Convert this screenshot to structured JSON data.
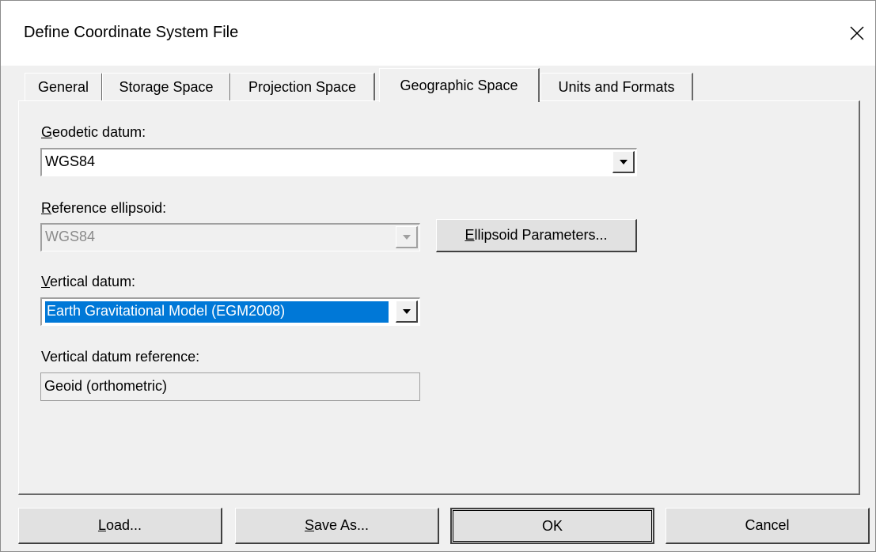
{
  "window": {
    "title": "Define Coordinate System File"
  },
  "tabs": [
    {
      "label": "General"
    },
    {
      "label": "Storage Space"
    },
    {
      "label": "Projection Space"
    },
    {
      "label": "Geographic Space"
    },
    {
      "label": "Units and Formats"
    }
  ],
  "active_tab": "Geographic Space",
  "geodetic": {
    "label_first": "G",
    "label_rest": "eodetic datum:",
    "value": "WGS84"
  },
  "ellipsoid": {
    "label_first": "R",
    "label_rest": "eference ellipsoid:",
    "value": "WGS84",
    "button_first": "E",
    "button_rest": "llipsoid Parameters..."
  },
  "vertical": {
    "label_first": "V",
    "label_rest": "ertical datum:",
    "value": "Earth Gravitational Model (EGM2008)"
  },
  "vertical_ref": {
    "label": "Vertical datum reference:",
    "value": "Geoid (orthometric)"
  },
  "buttons": {
    "load_first": "L",
    "load_rest": "oad...",
    "saveas_first": "S",
    "saveas_rest": "ave As...",
    "ok": "OK",
    "cancel": "Cancel"
  },
  "colors": {
    "selection": "#0078d7",
    "background": "#f0f0f0"
  }
}
